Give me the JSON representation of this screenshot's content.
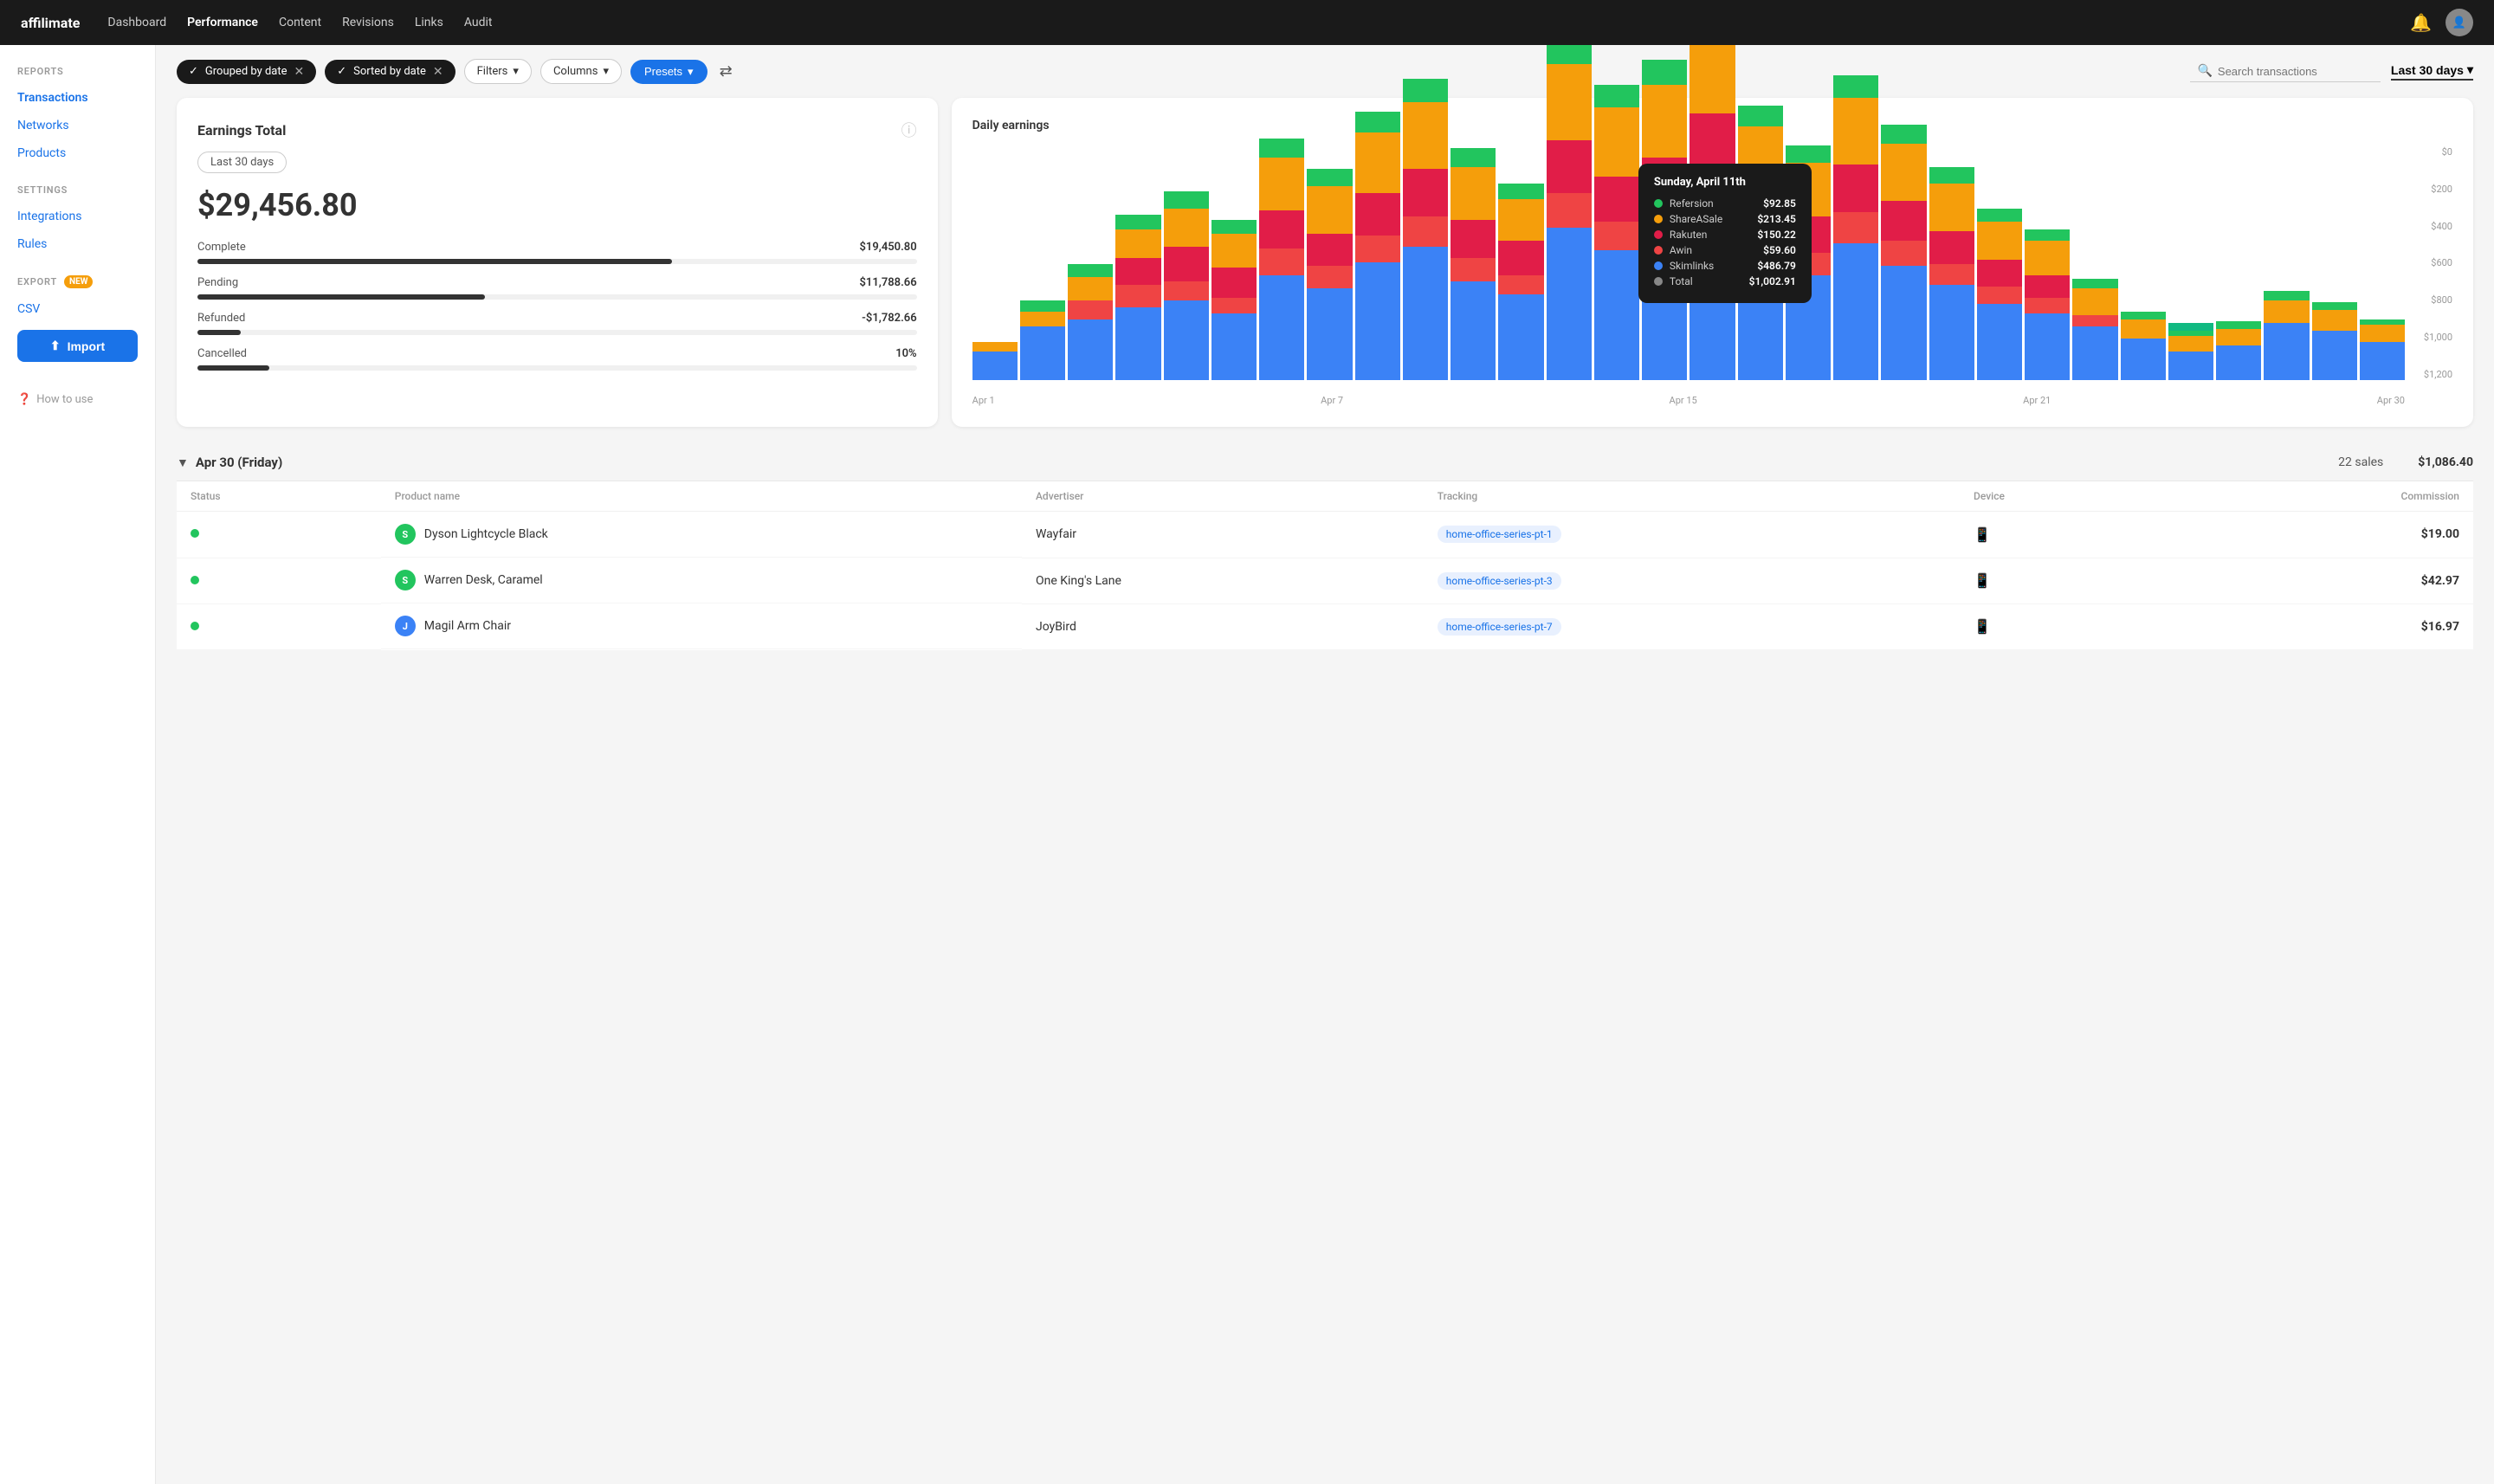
{
  "app": {
    "logo": "affilimate",
    "nav_links": [
      {
        "label": "Dashboard",
        "active": false
      },
      {
        "label": "Performance",
        "active": true
      },
      {
        "label": "Content",
        "active": false
      },
      {
        "label": "Revisions",
        "active": false
      },
      {
        "label": "Links",
        "active": false
      },
      {
        "label": "Audit",
        "active": false
      }
    ]
  },
  "sidebar": {
    "reports_label": "REPORTS",
    "transactions_label": "Transactions",
    "networks_label": "Networks",
    "products_label": "Products",
    "settings_label": "SETTINGS",
    "integrations_label": "Integrations",
    "rules_label": "Rules",
    "export_label": "EXPORT",
    "new_badge": "NEW",
    "csv_label": "CSV",
    "import_label": "Import",
    "how_to_use_label": "How to use"
  },
  "filters": {
    "grouped_by_date": "Grouped by date",
    "sorted_by_date": "Sorted by date",
    "filters_label": "Filters",
    "columns_label": "Columns",
    "presets_label": "Presets",
    "search_placeholder": "Search transactions",
    "date_range": "Last 30 days"
  },
  "earnings_card": {
    "title": "Earnings Total",
    "period": "Last 30 days",
    "total": "$29,456.80",
    "rows": [
      {
        "label": "Complete",
        "value": "$19,450.80",
        "pct": 66
      },
      {
        "label": "Pending",
        "value": "$11,788.66",
        "pct": 40
      },
      {
        "label": "Refunded",
        "value": "-$1,782.66",
        "pct": 6
      },
      {
        "label": "Cancelled",
        "value": "10%",
        "pct": 10
      }
    ]
  },
  "chart": {
    "title": "Daily earnings",
    "y_axis": [
      "$0",
      "$200",
      "$400",
      "$600",
      "$800",
      "$1,000",
      "$1,200"
    ],
    "x_axis": [
      "Apr 1",
      "Apr 7",
      "Apr 15",
      "Apr 21",
      "Apr 30"
    ],
    "tooltip": {
      "title": "Sunday, April 11th",
      "rows": [
        {
          "label": "Refersion",
          "value": "$92.85",
          "color": "#22c55e"
        },
        {
          "label": "ShareASale",
          "value": "$213.45",
          "color": "#f59e0b"
        },
        {
          "label": "Rakuten",
          "value": "$150.22",
          "color": "#e11d48"
        },
        {
          "label": "Awin",
          "value": "$59.60",
          "color": "#ef4444"
        },
        {
          "label": "Skimlinks",
          "value": "$486.79",
          "color": "#3b82f6"
        },
        {
          "label": "Total",
          "value": "$1,002.91",
          "color": "#888"
        }
      ]
    },
    "bars": [
      {
        "segments": [
          {
            "color": "#3b82f6",
            "h": 15
          },
          {
            "color": "#f59e0b",
            "h": 5
          }
        ]
      },
      {
        "segments": [
          {
            "color": "#3b82f6",
            "h": 28
          },
          {
            "color": "#f59e0b",
            "h": 8
          },
          {
            "color": "#22c55e",
            "h": 6
          }
        ]
      },
      {
        "segments": [
          {
            "color": "#3b82f6",
            "h": 32
          },
          {
            "color": "#ef4444",
            "h": 10
          },
          {
            "color": "#f59e0b",
            "h": 12
          },
          {
            "color": "#22c55e",
            "h": 7
          }
        ]
      },
      {
        "segments": [
          {
            "color": "#3b82f6",
            "h": 38
          },
          {
            "color": "#ef4444",
            "h": 12
          },
          {
            "color": "#e11d48",
            "h": 14
          },
          {
            "color": "#f59e0b",
            "h": 15
          },
          {
            "color": "#22c55e",
            "h": 8
          }
        ]
      },
      {
        "segments": [
          {
            "color": "#3b82f6",
            "h": 42
          },
          {
            "color": "#ef4444",
            "h": 10
          },
          {
            "color": "#e11d48",
            "h": 18
          },
          {
            "color": "#f59e0b",
            "h": 20
          },
          {
            "color": "#22c55e",
            "h": 9
          }
        ]
      },
      {
        "segments": [
          {
            "color": "#3b82f6",
            "h": 35
          },
          {
            "color": "#ef4444",
            "h": 8
          },
          {
            "color": "#e11d48",
            "h": 16
          },
          {
            "color": "#f59e0b",
            "h": 18
          },
          {
            "color": "#22c55e",
            "h": 7
          }
        ]
      },
      {
        "segments": [
          {
            "color": "#3b82f6",
            "h": 55
          },
          {
            "color": "#ef4444",
            "h": 14
          },
          {
            "color": "#e11d48",
            "h": 20
          },
          {
            "color": "#f59e0b",
            "h": 28
          },
          {
            "color": "#22c55e",
            "h": 10
          }
        ]
      },
      {
        "segments": [
          {
            "color": "#3b82f6",
            "h": 48
          },
          {
            "color": "#ef4444",
            "h": 12
          },
          {
            "color": "#e11d48",
            "h": 17
          },
          {
            "color": "#f59e0b",
            "h": 25
          },
          {
            "color": "#22c55e",
            "h": 9
          }
        ]
      },
      {
        "segments": [
          {
            "color": "#3b82f6",
            "h": 62
          },
          {
            "color": "#ef4444",
            "h": 14
          },
          {
            "color": "#e11d48",
            "h": 22
          },
          {
            "color": "#f59e0b",
            "h": 32
          },
          {
            "color": "#22c55e",
            "h": 11
          }
        ]
      },
      {
        "segments": [
          {
            "color": "#3b82f6",
            "h": 70
          },
          {
            "color": "#ef4444",
            "h": 16
          },
          {
            "color": "#e11d48",
            "h": 25
          },
          {
            "color": "#f59e0b",
            "h": 35
          },
          {
            "color": "#22c55e",
            "h": 12
          }
        ]
      },
      {
        "segments": [
          {
            "color": "#3b82f6",
            "h": 52
          },
          {
            "color": "#ef4444",
            "h": 12
          },
          {
            "color": "#e11d48",
            "h": 20
          },
          {
            "color": "#f59e0b",
            "h": 28
          },
          {
            "color": "#22c55e",
            "h": 10
          }
        ]
      },
      {
        "segments": [
          {
            "color": "#3b82f6",
            "h": 45
          },
          {
            "color": "#ef4444",
            "h": 10
          },
          {
            "color": "#e11d48",
            "h": 18
          },
          {
            "color": "#f59e0b",
            "h": 22
          },
          {
            "color": "#22c55e",
            "h": 8
          }
        ]
      },
      {
        "segments": [
          {
            "color": "#3b82f6",
            "h": 80
          },
          {
            "color": "#ef4444",
            "h": 18
          },
          {
            "color": "#e11d48",
            "h": 28
          },
          {
            "color": "#f59e0b",
            "h": 40
          },
          {
            "color": "#22c55e",
            "h": 14
          }
        ]
      },
      {
        "segments": [
          {
            "color": "#3b82f6",
            "h": 68
          },
          {
            "color": "#ef4444",
            "h": 15
          },
          {
            "color": "#e11d48",
            "h": 24
          },
          {
            "color": "#f59e0b",
            "h": 36
          },
          {
            "color": "#22c55e",
            "h": 12
          }
        ]
      },
      {
        "segments": [
          {
            "color": "#3b82f6",
            "h": 75
          },
          {
            "color": "#ef4444",
            "h": 16
          },
          {
            "color": "#e11d48",
            "h": 26
          },
          {
            "color": "#f59e0b",
            "h": 38
          },
          {
            "color": "#22c55e",
            "h": 13
          }
        ]
      },
      {
        "segments": [
          {
            "color": "#3b82f6",
            "h": 90
          },
          {
            "color": "#ef4444",
            "h": 20
          },
          {
            "color": "#e11d48",
            "h": 30
          },
          {
            "color": "#f59e0b",
            "h": 45
          },
          {
            "color": "#22c55e",
            "h": 15
          },
          {
            "color": "#10b981",
            "h": 5
          }
        ]
      },
      {
        "segments": [
          {
            "color": "#3b82f6",
            "h": 65
          },
          {
            "color": "#ef4444",
            "h": 14
          },
          {
            "color": "#e11d48",
            "h": 22
          },
          {
            "color": "#f59e0b",
            "h": 32
          },
          {
            "color": "#22c55e",
            "h": 11
          }
        ]
      },
      {
        "segments": [
          {
            "color": "#3b82f6",
            "h": 55
          },
          {
            "color": "#ef4444",
            "h": 12
          },
          {
            "color": "#e11d48",
            "h": 19
          },
          {
            "color": "#f59e0b",
            "h": 28
          },
          {
            "color": "#22c55e",
            "h": 9
          }
        ]
      },
      {
        "segments": [
          {
            "color": "#3b82f6",
            "h": 72
          },
          {
            "color": "#ef4444",
            "h": 16
          },
          {
            "color": "#e11d48",
            "h": 25
          },
          {
            "color": "#f59e0b",
            "h": 35
          },
          {
            "color": "#22c55e",
            "h": 12
          }
        ]
      },
      {
        "segments": [
          {
            "color": "#3b82f6",
            "h": 60
          },
          {
            "color": "#ef4444",
            "h": 13
          },
          {
            "color": "#e11d48",
            "h": 21
          },
          {
            "color": "#f59e0b",
            "h": 30
          },
          {
            "color": "#22c55e",
            "h": 10
          }
        ]
      },
      {
        "segments": [
          {
            "color": "#3b82f6",
            "h": 50
          },
          {
            "color": "#ef4444",
            "h": 11
          },
          {
            "color": "#e11d48",
            "h": 17
          },
          {
            "color": "#f59e0b",
            "h": 25
          },
          {
            "color": "#22c55e",
            "h": 9
          }
        ]
      },
      {
        "segments": [
          {
            "color": "#3b82f6",
            "h": 40
          },
          {
            "color": "#ef4444",
            "h": 9
          },
          {
            "color": "#e11d48",
            "h": 14
          },
          {
            "color": "#f59e0b",
            "h": 20
          },
          {
            "color": "#22c55e",
            "h": 7
          }
        ]
      },
      {
        "segments": [
          {
            "color": "#3b82f6",
            "h": 35
          },
          {
            "color": "#ef4444",
            "h": 8
          },
          {
            "color": "#e11d48",
            "h": 12
          },
          {
            "color": "#f59e0b",
            "h": 18
          },
          {
            "color": "#22c55e",
            "h": 6
          }
        ]
      },
      {
        "segments": [
          {
            "color": "#3b82f6",
            "h": 28
          },
          {
            "color": "#ef4444",
            "h": 6
          },
          {
            "color": "#f59e0b",
            "h": 14
          },
          {
            "color": "#22c55e",
            "h": 5
          }
        ]
      },
      {
        "segments": [
          {
            "color": "#3b82f6",
            "h": 22
          },
          {
            "color": "#f59e0b",
            "h": 10
          },
          {
            "color": "#22c55e",
            "h": 4
          }
        ]
      },
      {
        "segments": [
          {
            "color": "#3b82f6",
            "h": 15
          },
          {
            "color": "#f59e0b",
            "h": 8
          },
          {
            "color": "#22c55e",
            "h": 3
          },
          {
            "color": "#10b981",
            "h": 4
          }
        ]
      },
      {
        "segments": [
          {
            "color": "#3b82f6",
            "h": 18
          },
          {
            "color": "#f59e0b",
            "h": 9
          },
          {
            "color": "#22c55e",
            "h": 4
          }
        ]
      },
      {
        "segments": [
          {
            "color": "#3b82f6",
            "h": 30
          },
          {
            "color": "#f59e0b",
            "h": 12
          },
          {
            "color": "#22c55e",
            "h": 5
          }
        ]
      },
      {
        "segments": [
          {
            "color": "#3b82f6",
            "h": 26
          },
          {
            "color": "#f59e0b",
            "h": 11
          },
          {
            "color": "#22c55e",
            "h": 4
          }
        ]
      },
      {
        "segments": [
          {
            "color": "#3b82f6",
            "h": 20
          },
          {
            "color": "#f59e0b",
            "h": 9
          },
          {
            "color": "#22c55e",
            "h": 3
          }
        ]
      }
    ]
  },
  "date_group": {
    "label": "Apr 30 (Friday)",
    "sales_count": "22 sales",
    "total": "$1,086.40"
  },
  "table": {
    "headers": [
      "Status",
      "Product name",
      "Advertiser",
      "Tracking",
      "Device",
      "Commission"
    ],
    "rows": [
      {
        "status": "complete",
        "network_abbr": "S",
        "network_color": "green",
        "product": "Dyson Lightcycle Black",
        "advertiser": "Wayfair",
        "tracking": "home-office-series-pt-1",
        "device": "mobile",
        "commission": "$19.00"
      },
      {
        "status": "complete",
        "network_abbr": "S",
        "network_color": "green",
        "product": "Warren Desk, Caramel",
        "advertiser": "One King's Lane",
        "tracking": "home-office-series-pt-3",
        "device": "mobile",
        "commission": "$42.97"
      },
      {
        "status": "complete",
        "network_abbr": "J",
        "network_color": "blue",
        "product": "Magil Arm Chair",
        "advertiser": "JoyBird",
        "tracking": "home-office-series-pt-7",
        "device": "mobile",
        "commission": "$16.97"
      }
    ]
  }
}
